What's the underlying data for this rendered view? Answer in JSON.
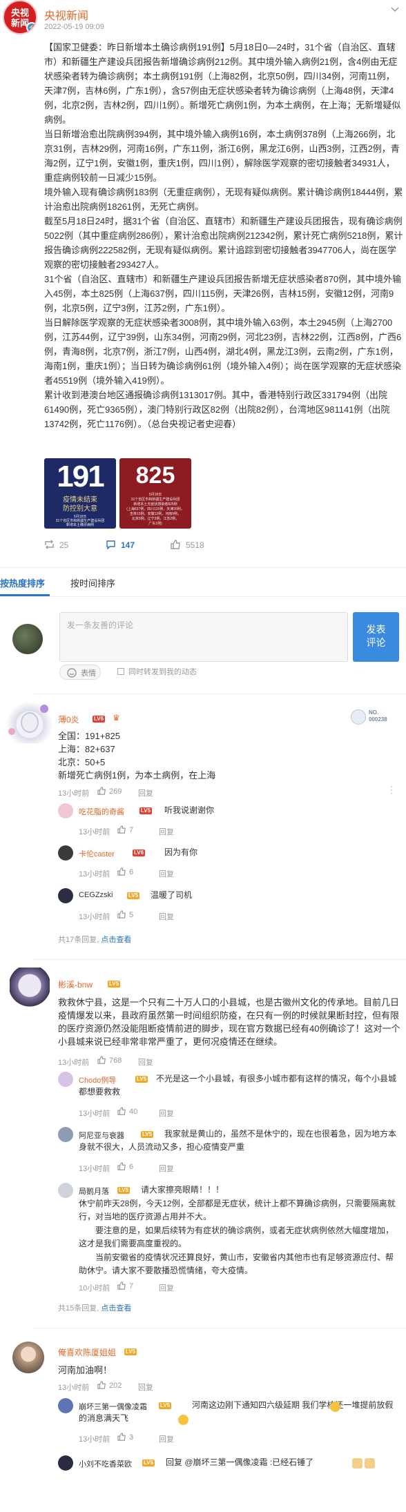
{
  "post": {
    "author": "央视新闻",
    "logo_line1": "央视",
    "logo_line2": "新闻",
    "time": "2022-05-19 09:09",
    "paragraphs": [
      "【国家卫健委：昨日新增本土确诊病例191例】5月18日0—24时，31个省（自治区、直辖市）和新疆生产建设兵团报告新增确诊病例212例。其中境外输入病例21例，含4例由无症状感染者转为确诊病例；本土病例191例（上海82例，北京50例，四川34例，河南11例，天津7例，吉林6例，广东1例），含57例由无症状感染者转为确诊病例（上海48例，天津4例，北京2例，吉林2例，四川1例）。新增死亡病例1例，为本土病例，在上海；无新增疑似病例。",
      "当日新增治愈出院病例394例，其中境外输入病例16例，本土病例378例（上海266例，北京31例，吉林29例，河南16例，广东11例，浙江6例，黑龙江6例，山西3例，江西2例，青海2例，辽宁1例，安徽1例，重庆1例，四川1例），解除医学观察的密切接触者34931人，重症病例较前一日减少15例。",
      "境外输入现有确诊病例183例（无重症病例），无现有疑似病例。累计确诊病例18444例，累计治愈出院病例18261例，无死亡病例。",
      "截至5月18日24时，据31个省（自治区、直辖市）和新疆生产建设兵团报告，现有确诊病例5022例（其中重症病例286例），累计治愈出院病例212342例，累计死亡病例5218例，累计报告确诊病例222582例，无现有疑似病例。累计追踪到密切接触者3947706人，尚在医学观察的密切接触者293427人。",
      "31个省（自治区、直辖市）和新疆生产建设兵团报告新增无症状感染者870例，其中境外输入45例，本土825例（上海637例，四川115例，天津26例，吉林15例，安徽12例，河南9例，北京5例，辽宁3例，江苏2例，广东1例）。",
      "当日解除医学观察的无症状感染者3008例，其中境外输入63例，本土2945例（上海2700例，江苏44例，辽宁39例，山东34例，河南29例，河北23例，吉林22例，江西8例，广西6例，青海8例，北京7例，浙江7例，山西4例，湖北4例，黑龙江3例，云南2例，广东1例，海南1例，重庆1例）；当日转为确诊病例61例（境外输入4例）；尚在医学观察的无症状感染者45519例（境外输入419例）。",
      "累计收到港澳台地区通报确诊病例1313017例。其中，香港特别行政区331794例（出院61490例，死亡9365例），澳门特别行政区82例（出院82例），台湾地区981141例（出院13742例，死亡1176例）。（总台央视记者史迎春）"
    ],
    "image1": {
      "number": "191",
      "line1": "疫情未结束",
      "line2": "防控别大意",
      "line3": "5月18日",
      "line4": "31个省区市和新疆生产建设兵团",
      "line5": "新增本土确诊病例"
    },
    "image2": {
      "number": "825",
      "line1": "5月18日",
      "line2": "31个省区市和新疆生产建设兵团",
      "line3": "新增本土无症状感染者825例",
      "line4": "(上海637例，四川115例，天津26例，",
      "line5": "吉林15例，安徽12例，河南9例，",
      "line6": "北京5例，辽宁3例，江苏2例，",
      "line7": "广东1例)"
    },
    "reposts": "25",
    "comments": "147",
    "likes": "5518"
  },
  "tabs": {
    "hot": "按热度排序",
    "time": "按时间排序"
  },
  "composer": {
    "placeholder": "发一条友善的评论",
    "send_line1": "发表",
    "send_line2": "评论",
    "emoji": "表情",
    "repost_label": "同时转发到我的动态"
  },
  "colors": {
    "accent": "#2a72c4",
    "name": "#e3682a",
    "send": "#3a8ae0"
  },
  "comments": [
    {
      "user": "薄0炎",
      "level": "LV6",
      "badge": "NO. 000238",
      "lines": [
        "全国：191+825",
        "上海：82+637",
        "北京：50+5",
        "新增死亡病例1例，为本土病例，在上海"
      ],
      "time": "13小时前",
      "likes": "269",
      "reply": "回复",
      "replies": [
        {
          "user": "吃花脂的奇酱",
          "level": "LV5",
          "text": "听我说谢谢你",
          "time": "13小时前",
          "likes": "7",
          "reply": "回复"
        },
        {
          "user": "卡伦caster",
          "level": "LV6",
          "text": "因为有你",
          "time": "13小时前",
          "likes": "6",
          "reply": "回复"
        },
        {
          "user": "CEGZzski",
          "level": "LV5",
          "text": "温暖了司机",
          "time": "13小时前",
          "likes": "5",
          "reply": "回复"
        }
      ],
      "more_prefix": "共17条回复,",
      "more_link": "点击查看"
    },
    {
      "user": "彬溪-bnw",
      "level": "LV5",
      "lines": [
        "救救休宁县，这是一个只有二十万人口的小县城，也是古徽州文化的传承地。目前几日疫情爆发以来，县政府虽然第一时间组织防疫，在只有一例的时候就果断封控，但有限的医疗资源仍然没能阻断疫情前进的脚步，现在官方数据已经有40例确诊了！这对一个小县城来说已经非常非常严重了，更何况疫情还在继续。"
      ],
      "time": "13小时前",
      "likes": "768",
      "reply": "回复",
      "replies": [
        {
          "user": "Chodo例导",
          "level": "LV5",
          "text": "不光是这一个小县城，有很多小城市都有这样的情况，每个小县城都想要救救",
          "time": "13小时前",
          "likes": "40",
          "reply": "回复"
        },
        {
          "user": "阿尼亚与衰器",
          "level": "LV5",
          "text": "我家就是黄山的，虽然不是休宁的，现在也很着急，因为地方本身就不很大，人员流动又多，担心疫情变严重",
          "time": "13小时前",
          "likes": "6",
          "reply": "回复"
        },
        {
          "user": "局鹅月落",
          "level": "LV5",
          "text": "请大家擦亮眼睛！！！",
          "time": "10小时前",
          "likes": "7",
          "reply": "回复",
          "extra": [
            "休宁前昨天28例，今天12例，全部都是无症状，统计上都不算确诊病例，只需要隔离就行，对当地的医疗资源占用并不大。",
            "要注意的是，如果后续转为有症状的确诊病例，或者无症状病例依然大幅度增加，这才是我们需要高度重视的。",
            "当前安徽省的疫情状况还算良好，黄山市，安徽省内其他市也有足够资源应付、帮助休宁。请大家不要散播恐慌情绪，夸大疫情。"
          ]
        }
      ],
      "more_prefix": "共15条回复,",
      "more_link": "点击查看"
    },
    {
      "user": "俺喜欢陈厦姐姐",
      "level": "LV5",
      "lines": [
        "河南加油啊！"
      ],
      "time": "13小时前",
      "likes": "202",
      "reply": "回复",
      "replies": [
        {
          "user": "崩坏三第一偶像凌霜",
          "level": "LV5",
          "text": "河南这边刚下通知四六级延期 我们学校还一堆提前放假的消息满天飞",
          "time": "13小时前",
          "likes": "3",
          "reply": "回复"
        },
        {
          "user": "小刘不吃香菜欧",
          "level": "LV5",
          "text": "回复 @崩坏三第一偶像凌霜 :已经石锤了",
          "time": "",
          "likes": "",
          "reply": ""
        }
      ]
    }
  ]
}
